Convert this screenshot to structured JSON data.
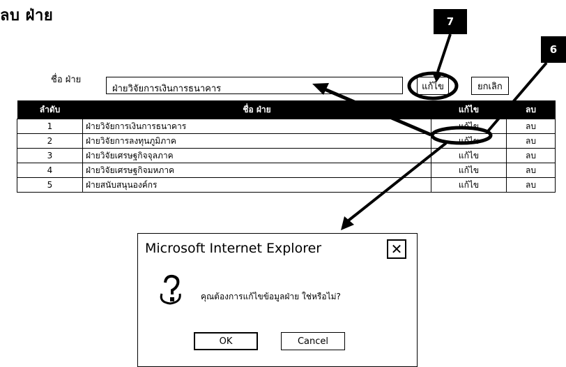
{
  "page": {
    "title": "ลบ ฝ่าย"
  },
  "callouts": {
    "a": "7",
    "b": "6"
  },
  "form": {
    "name_label": "ชื่อ ฝ่าย",
    "name_value": "ฝ่ายวิจัยการเงินการธนาคาร",
    "edit_label": "แก้ไข",
    "cancel_label": "ยกเลิก"
  },
  "table": {
    "headers": [
      "ลำดับ",
      "ชื่อ ฝ่าย",
      "แก้ไข",
      "ลบ"
    ],
    "rows": [
      {
        "no": "1",
        "name": "ฝ่ายวิจัยการเงินการธนาคาร",
        "edit": "แก้ไข",
        "delete": "ลบ"
      },
      {
        "no": "2",
        "name": "ฝ่ายวิจัยการลงทุนภูมิภาค",
        "edit": "แก้ไข",
        "delete": "ลบ"
      },
      {
        "no": "3",
        "name": "ฝ่ายวิจัยเศรษฐกิจจุลภาค",
        "edit": "แก้ไข",
        "delete": "ลบ"
      },
      {
        "no": "4",
        "name": "ฝ่ายวิจัยเศรษฐกิจมหภาค",
        "edit": "แก้ไข",
        "delete": "ลบ"
      },
      {
        "no": "5",
        "name": "ฝ่ายสนับสนุนองค์กร",
        "edit": "แก้ไข",
        "delete": "ลบ"
      }
    ]
  },
  "dialog": {
    "title": "Microsoft Internet Explorer",
    "close_glyph": "✕",
    "message": "คุณต้องการแก้ไขข้อมูลฝ่าย ใช่หรือไม่?",
    "ok_label": "OK",
    "cancel_label": "Cancel",
    "icon": "question-icon"
  }
}
